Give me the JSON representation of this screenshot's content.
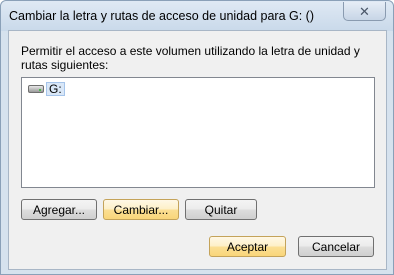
{
  "window": {
    "title": "Cambiar la letra y rutas de acceso de unidad para G: ()",
    "close_symbol": "✕"
  },
  "dialog": {
    "prompt": "Permitir el acceso a este volumen utilizando la letra de unidad y rutas siguientes:",
    "list_items": [
      {
        "label": "G:",
        "icon": "drive-icon",
        "selected": true
      }
    ]
  },
  "buttons": {
    "add": "Agregar...",
    "change": "Cambiar...",
    "remove": "Quitar",
    "ok": "Aceptar",
    "cancel": "Cancelar"
  }
}
